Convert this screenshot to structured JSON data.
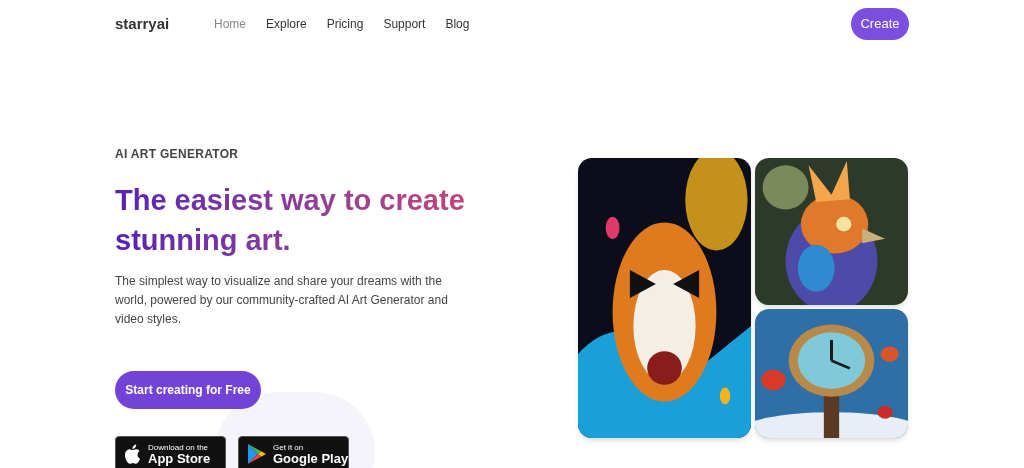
{
  "header": {
    "logo": "starryai",
    "nav": [
      {
        "label": "Home",
        "selected": true
      },
      {
        "label": "Explore",
        "selected": false
      },
      {
        "label": "Pricing",
        "selected": false
      },
      {
        "label": "Support",
        "selected": false
      },
      {
        "label": "Blog",
        "selected": false
      }
    ],
    "cta": "Create"
  },
  "hero": {
    "eyebrow": "AI ART GENERATOR",
    "heading": [
      "The easiest way to create",
      "stunning art."
    ],
    "description": "The simplest way to visualize and share your dreams with the world, powered by our community-crafted AI Art Generator and video styles.",
    "button": "Start creating for Free",
    "stores": [
      {
        "kind": "apple",
        "small": "Download on the",
        "big": "App Store"
      },
      {
        "kind": "google",
        "small": "Get it on",
        "big": "Google Play"
      }
    ]
  }
}
